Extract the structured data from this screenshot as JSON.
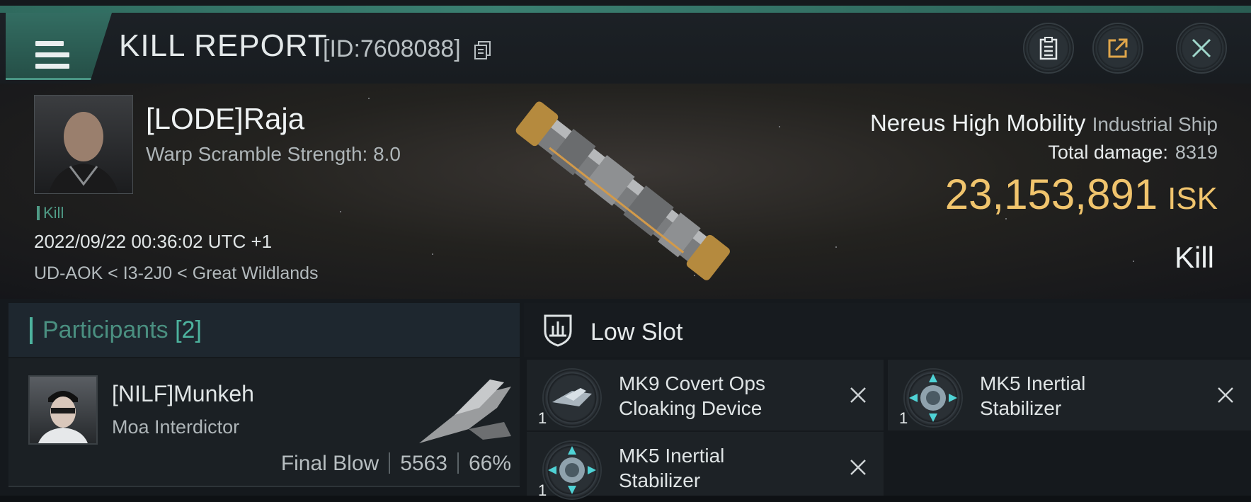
{
  "header": {
    "title": "KILL REPORT",
    "id_label": "[ID:7608088]",
    "menu_icon": "hamburger-icon",
    "buttons": [
      "clipboard-icon",
      "share-icon",
      "close-icon"
    ]
  },
  "victim": {
    "name": "[LODE]Raja",
    "warp_scramble": "Warp Scramble Strength: 8.0",
    "tag": "Kill",
    "datetime": "2022/09/22 00:36:02 UTC +1",
    "location": "UD-AOK < I3-2J0 < Great Wildlands"
  },
  "ship": {
    "name": "Nereus High Mobility",
    "class": "Industrial Ship",
    "total_damage_label": "Total damage:",
    "total_damage_value": "8319",
    "isk_value": "23,153,891",
    "isk_unit": "ISK",
    "result": "Kill"
  },
  "participants": {
    "title": "Participants",
    "count": "[2]",
    "items": [
      {
        "name": "[NILF]Munkeh",
        "ship": "Moa Interdictor",
        "role": "Final Blow",
        "damage": "5563",
        "percent": "66%"
      }
    ]
  },
  "low_slot": {
    "title": "Low Slot",
    "modules": [
      {
        "qty": "1",
        "name_line1": "MK9 Covert Ops",
        "name_line2": "Cloaking Device",
        "icon": "cloaking-device-icon"
      },
      {
        "qty": "1",
        "name_line1": "MK5 Inertial",
        "name_line2": "Stabilizer",
        "icon": "inertial-stabilizer-icon"
      },
      {
        "qty": "1",
        "name_line1": "MK5 Inertial",
        "name_line2": "Stabilizer",
        "icon": "inertial-stabilizer-icon"
      }
    ]
  },
  "colors": {
    "accent": "#3a7f71",
    "isk": "#f0c46d",
    "participants_title": "#4a8f80"
  }
}
